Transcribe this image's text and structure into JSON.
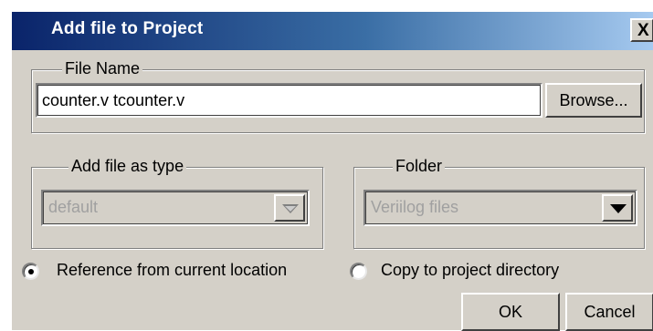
{
  "dialog": {
    "title": "Add file to Project",
    "close_label": "X"
  },
  "file_name": {
    "group_label": "File Name",
    "value": "counter.v tcounter.v",
    "browse_label": "Browse..."
  },
  "file_type": {
    "group_label": "Add file as type",
    "selected": "default",
    "enabled": false
  },
  "folder": {
    "group_label": "Folder",
    "selected": "Veriilog files",
    "enabled": true
  },
  "location": {
    "options": [
      {
        "label": "Reference from current location",
        "selected": true
      },
      {
        "label": "Copy to project directory",
        "selected": false
      }
    ]
  },
  "buttons": {
    "ok_label": "OK",
    "cancel_label": "Cancel"
  },
  "icons": {
    "close": "close-icon",
    "dropdown": "chevron-down-icon"
  },
  "colors": {
    "title_start": "#0a246a",
    "title_end": "#a6caf0",
    "face": "#d4d0c8"
  }
}
